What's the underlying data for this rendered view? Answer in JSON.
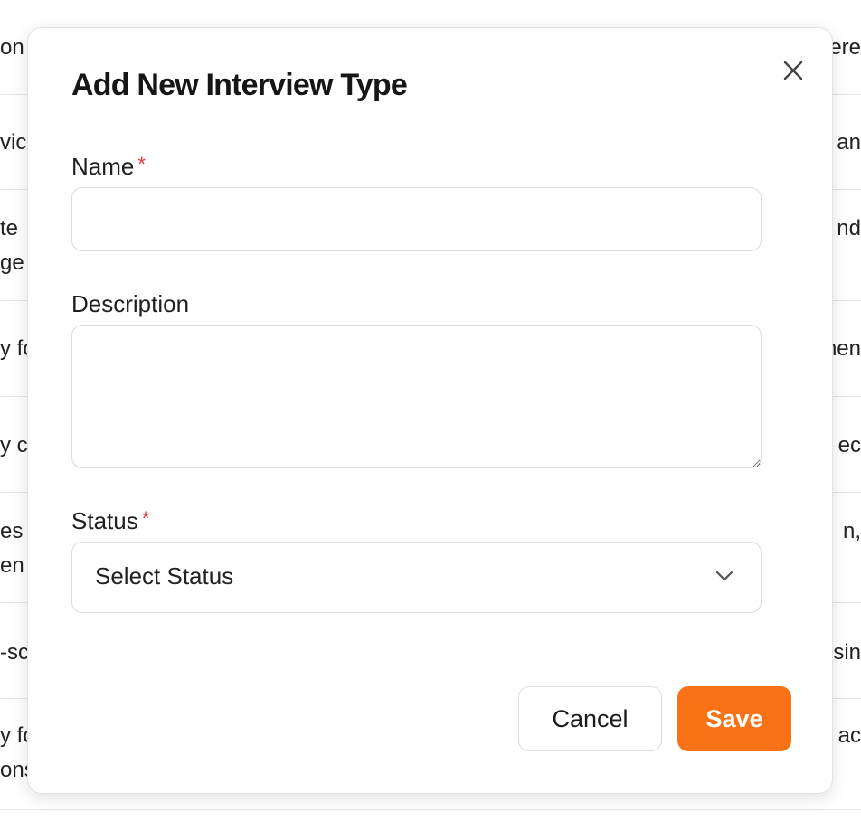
{
  "background_rows": [
    {
      "left": "on",
      "right": "ere"
    },
    {
      "left": "vic",
      "right": "an"
    },
    {
      "left": " te",
      "left2": "ge",
      "right": "nd"
    },
    {
      "left": "y fo",
      "right": "nen"
    },
    {
      "left": "y c",
      "right": "ec"
    },
    {
      "left": "es",
      "left2": "en",
      "right": "n,"
    },
    {
      "left": "-sc",
      "right": "sin"
    },
    {
      "left": "y fo",
      "left2": "ons",
      "right": " ac"
    }
  ],
  "modal": {
    "title": "Add New Interview Type",
    "close_label": "Close",
    "fields": {
      "name": {
        "label": "Name",
        "required_mark": "*",
        "value": "",
        "placeholder": ""
      },
      "description": {
        "label": "Description",
        "value": "",
        "placeholder": ""
      },
      "status": {
        "label": "Status",
        "required_mark": "*",
        "selected": "Select Status"
      }
    },
    "buttons": {
      "cancel": "Cancel",
      "save": "Save"
    }
  },
  "colors": {
    "accent": "#f97316",
    "required": "#e53935",
    "border": "#dcdcdc"
  },
  "icons": {
    "close": "close-icon",
    "dropdown": "chevron-down-icon"
  }
}
